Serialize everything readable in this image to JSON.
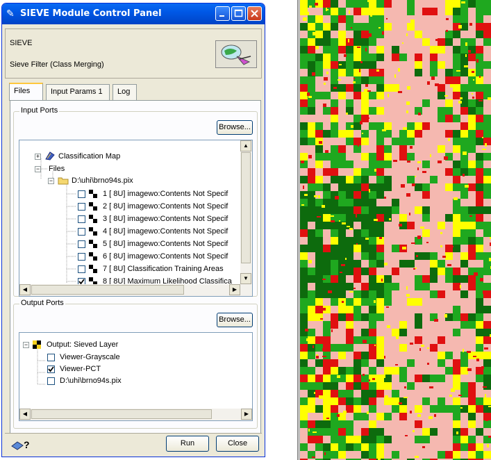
{
  "window": {
    "title": "SIEVE Module Control Panel"
  },
  "header": {
    "module_name": "SIEVE",
    "description": "Sieve Filter (Class Merging)"
  },
  "tabs": [
    {
      "label": "Files",
      "active": true
    },
    {
      "label": "Input Params 1",
      "active": false
    },
    {
      "label": "Log",
      "active": false
    }
  ],
  "input_ports": {
    "label": "Input Ports",
    "browse_label": "Browse...",
    "tree": {
      "classification_map": "Classification Map",
      "files": "Files",
      "file_path": "D:\\uhi\\brno94s.pix",
      "channels": [
        {
          "label": "1 [ 8U] imagewo:Contents Not Specif",
          "checked": false
        },
        {
          "label": "2 [ 8U] imagewo:Contents Not Specif",
          "checked": false
        },
        {
          "label": "3 [ 8U] imagewo:Contents Not Specif",
          "checked": false
        },
        {
          "label": "4 [ 8U] imagewo:Contents Not Specif",
          "checked": false
        },
        {
          "label": "5 [ 8U] imagewo:Contents Not Specif",
          "checked": false
        },
        {
          "label": "6 [ 8U] imagewo:Contents Not Specif",
          "checked": false
        },
        {
          "label": "7 [ 8U] Classification Training Areas",
          "checked": false
        },
        {
          "label": "8 [ 8U] Maximum Likelihood Classifica",
          "checked": true
        }
      ]
    }
  },
  "output_ports": {
    "label": "Output Ports",
    "browse_label": "Browse...",
    "tree": {
      "output": "Output: Sieved Layer",
      "items": [
        {
          "label": "Viewer-Grayscale",
          "checked": false
        },
        {
          "label": "Viewer-PCT",
          "checked": true
        },
        {
          "label": "D:\\uhi\\brno94s.pix",
          "checked": false
        }
      ]
    }
  },
  "footer": {
    "run_label": "Run",
    "close_label": "Close"
  },
  "colors": {
    "titlebar": "#0058e6",
    "map_green": "#1fa81f",
    "map_darkgreen": "#0d6b0d",
    "map_yellow": "#ffff00",
    "map_pink": "#f5b8b0",
    "map_red": "#e01010"
  }
}
